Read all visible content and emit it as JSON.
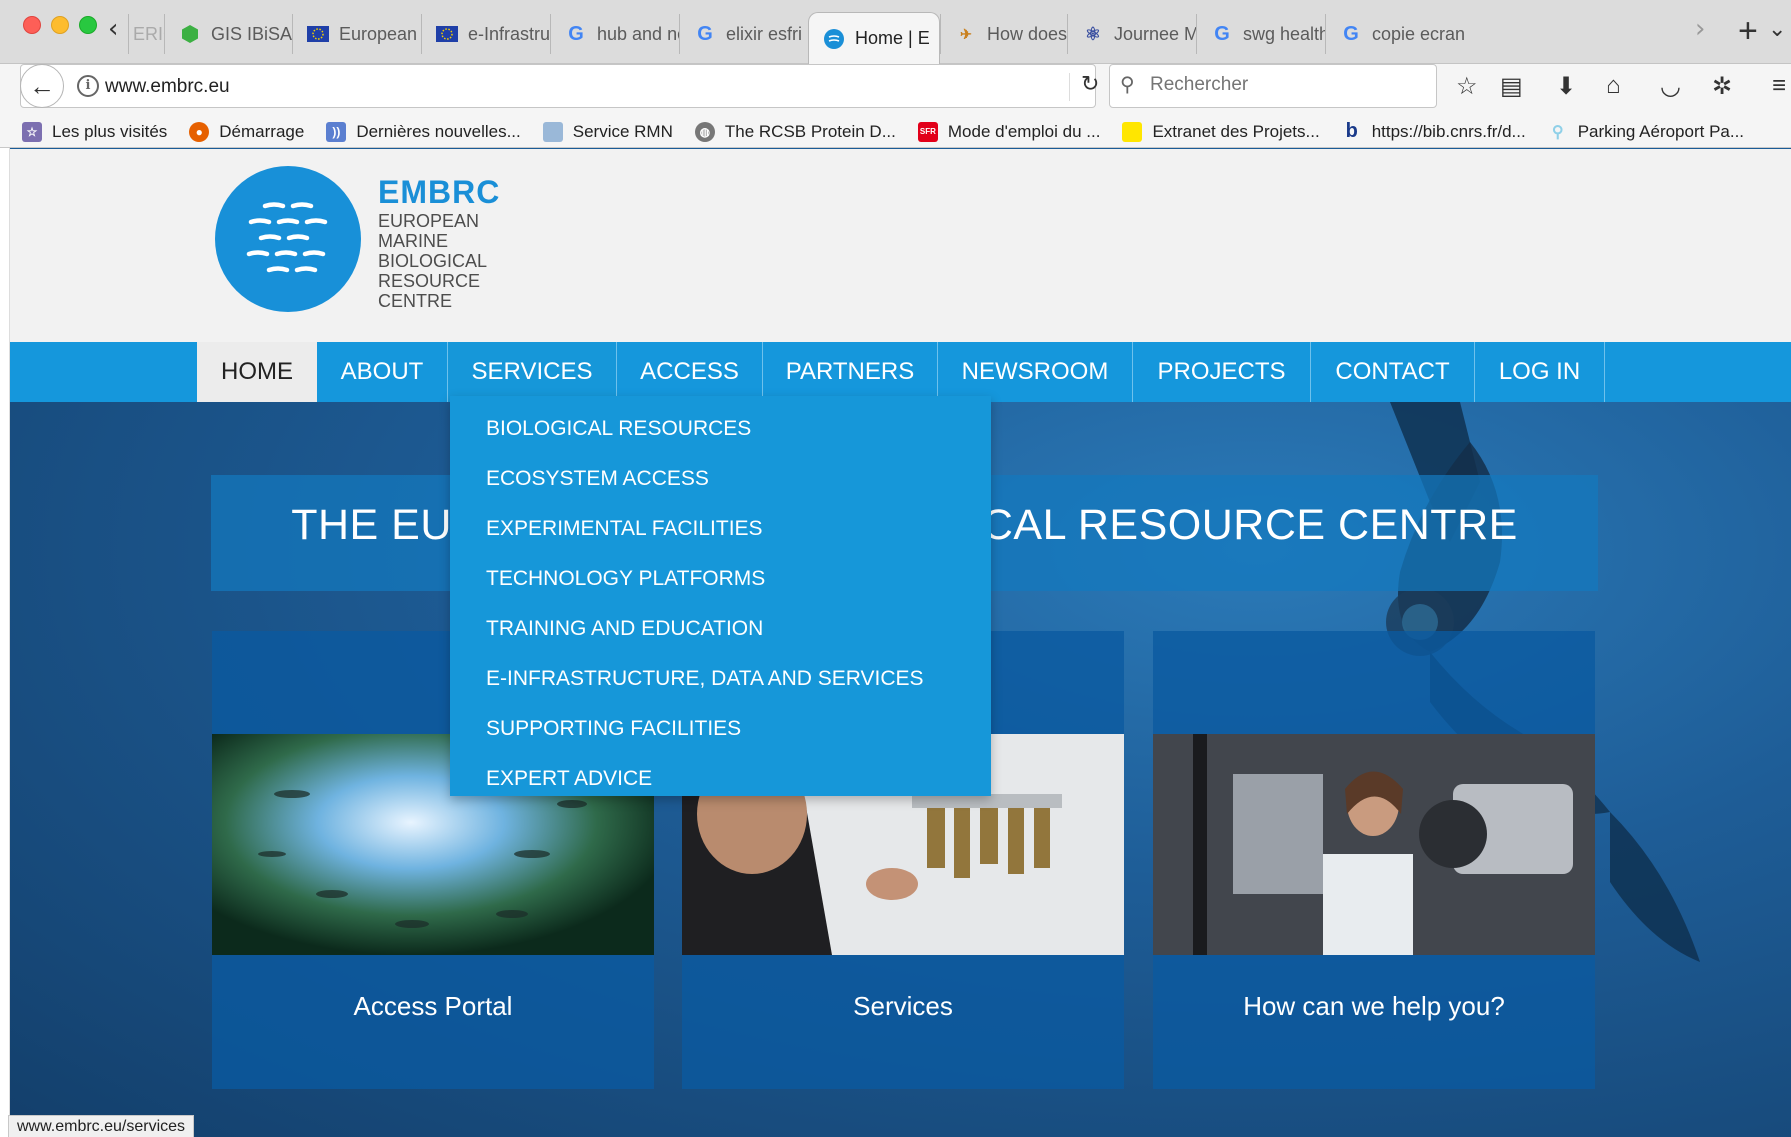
{
  "browser": {
    "tabs": [
      {
        "label": "ERIC",
        "favicon": "page-icon"
      },
      {
        "label": "GIS IBiSA :",
        "favicon": "green-hexagon-icon"
      },
      {
        "label": "European C",
        "favicon": "eu-flag-icon"
      },
      {
        "label": "e-Infrastruc",
        "favicon": "eu-flag-icon"
      },
      {
        "label": "hub and no",
        "favicon": "google-icon"
      },
      {
        "label": "elixir esfri -",
        "favicon": "google-icon"
      },
      {
        "label": "Home | E",
        "favicon": "embrc-icon",
        "active": true
      },
      {
        "label": "How does E",
        "favicon": "satellite-icon"
      },
      {
        "label": "Journee Mi",
        "favicon": "atom-icon"
      },
      {
        "label": "swg health",
        "favicon": "google-icon"
      },
      {
        "label": "copie ecran",
        "favicon": "google-icon"
      }
    ],
    "url": "www.embrc.eu",
    "search_placeholder": "Rechercher",
    "bookmarks": [
      {
        "label": "Les plus visités",
        "icon": "bookmarks-folder-icon"
      },
      {
        "label": "Démarrage",
        "icon": "firefox-icon"
      },
      {
        "label": "Dernières nouvelles...",
        "icon": "rss-icon"
      },
      {
        "label": "Service RMN",
        "icon": "folder-icon"
      },
      {
        "label": "The RCSB Protein D...",
        "icon": "globe-icon"
      },
      {
        "label": "Mode d'emploi du ...",
        "icon": "sfr-icon"
      },
      {
        "label": "Extranet des Projets...",
        "icon": "yellow-square-icon"
      },
      {
        "label": "https://bib.cnrs.fr/d...",
        "icon": "b-icon"
      },
      {
        "label": "Parking Aéroport Pa...",
        "icon": "pin-icon"
      }
    ],
    "status_url": "www.embrc.eu/services"
  },
  "site": {
    "logo": {
      "title": "EMBRC",
      "subtitle_lines": [
        "EUROPEAN",
        "MARINE",
        "BIOLOGICAL",
        "RESOURCE",
        "CENTRE"
      ]
    },
    "menu": [
      {
        "label": "HOME"
      },
      {
        "label": "ABOUT"
      },
      {
        "label": "SERVICES"
      },
      {
        "label": "ACCESS"
      },
      {
        "label": "PARTNERS"
      },
      {
        "label": "NEWSROOM"
      },
      {
        "label": "PROJECTS"
      },
      {
        "label": "CONTACT"
      },
      {
        "label": "LOG IN"
      }
    ],
    "services_dropdown": [
      "BIOLOGICAL RESOURCES",
      "ECOSYSTEM ACCESS",
      "EXPERIMENTAL FACILITIES",
      "TECHNOLOGY PLATFORMS",
      "TRAINING AND EDUCATION",
      "E-INFRASTRUCTURE, DATA AND SERVICES",
      "SUPPORTING FACILITIES",
      "EXPERT ADVICE"
    ],
    "banner_visible_left": "THE EU",
    "banner_visible_right": "CAL RESOURCE CENTRE",
    "cards": [
      {
        "label": "Access Portal"
      },
      {
        "label": "Services"
      },
      {
        "label": "How can we help you?"
      }
    ]
  },
  "colors": {
    "brand_blue": "#1597dc",
    "logo_text": "#1a8fd7",
    "hero_dark": "#133f6b"
  }
}
